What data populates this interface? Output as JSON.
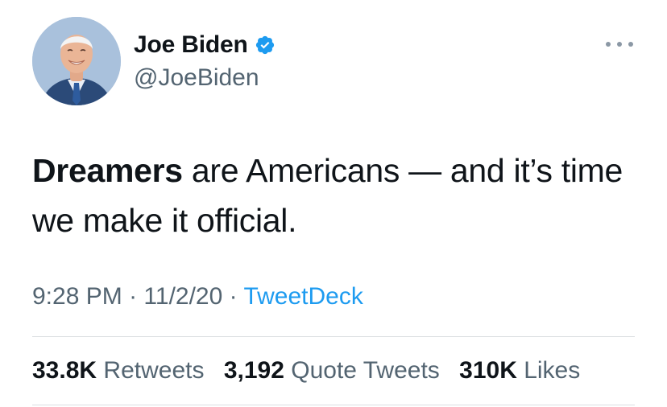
{
  "user": {
    "display_name": "Joe Biden",
    "handle": "@JoeBiden",
    "verified": true
  },
  "tweet": {
    "text_bold": "Dreamers",
    "text_rest": " are Americans — and it’s time we make it official.",
    "time": "9:28 PM",
    "separator": "·",
    "date": "11/2/20",
    "source": "TweetDeck"
  },
  "stats": {
    "retweets_count": "33.8K",
    "retweets_label": "Retweets",
    "quote_count": "3,192",
    "quote_label": "Quote Tweets",
    "likes_count": "310K",
    "likes_label": "Likes"
  },
  "colors": {
    "accent": "#1d9bf0",
    "text": "#0f1419",
    "secondary": "#536471"
  },
  "icons": {
    "verified": "verified-badge-icon",
    "more": "more-options-icon"
  }
}
